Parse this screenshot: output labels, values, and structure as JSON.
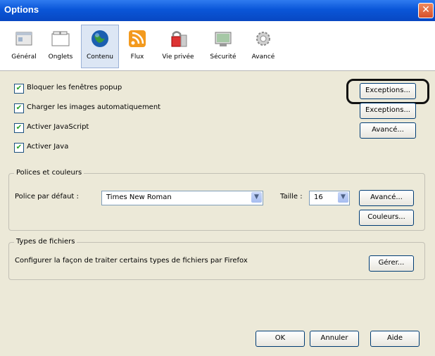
{
  "window": {
    "title": "Options",
    "close_symbol": "✕"
  },
  "toolbar": {
    "items": [
      {
        "label": "Général",
        "icon": "general-icon"
      },
      {
        "label": "Onglets",
        "icon": "tabs-icon"
      },
      {
        "label": "Contenu",
        "icon": "content-globe-icon",
        "active": true
      },
      {
        "label": "Flux",
        "icon": "feeds-icon"
      },
      {
        "label": "Vie privée",
        "icon": "privacy-icon"
      },
      {
        "label": "Sécurité",
        "icon": "security-icon"
      },
      {
        "label": "Avancé",
        "icon": "advanced-gear-icon"
      }
    ]
  },
  "content": {
    "options": [
      {
        "label": "Bloquer les fenêtres popup",
        "checked": true,
        "button": "Exceptions..."
      },
      {
        "label": "Charger les images automatiquement",
        "checked": true,
        "button": "Exceptions..."
      },
      {
        "label": "Activer JavaScript",
        "checked": true,
        "button": "Avancé..."
      },
      {
        "label": "Activer Java",
        "checked": true
      }
    ],
    "check_mark": "✔",
    "fonts": {
      "group_title": "Polices et couleurs",
      "default_font_label": "Police par défaut :",
      "default_font_value": "Times New Roman",
      "size_label": "Taille :",
      "size_value": "16",
      "advanced_button": "Avancé...",
      "colors_button": "Couleurs...",
      "dropdown_arrow": "▼"
    },
    "file_types": {
      "group_title": "Types de fichiers",
      "description": "Configurer la façon de traiter certains types de fichiers par Firefox",
      "manage_button": "Gérer..."
    }
  },
  "footer": {
    "ok": "OK",
    "cancel": "Annuler",
    "help": "Aide"
  },
  "colors": {
    "titlebar": "#0a56d8",
    "checkmark": "#21a121",
    "highlight": "#111111"
  }
}
